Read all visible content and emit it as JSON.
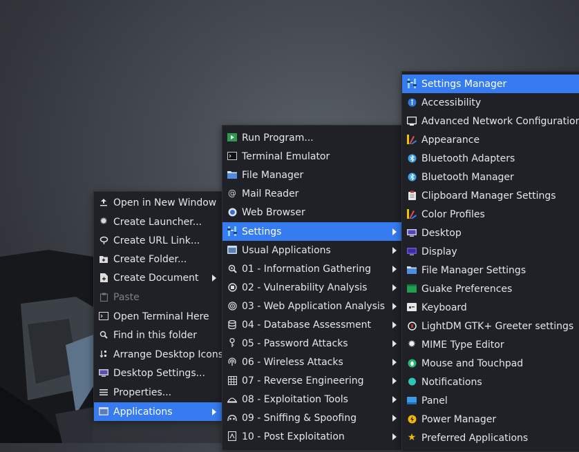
{
  "desktop_menu": {
    "items": [
      {
        "label": "Open in New Window",
        "icon": "upload-icon",
        "disabled": false,
        "submenu": false
      },
      {
        "label": "Create Launcher...",
        "icon": "gear-icon",
        "disabled": false,
        "submenu": false
      },
      {
        "label": "Create URL Link...",
        "icon": "link-icon",
        "disabled": false,
        "submenu": false
      },
      {
        "label": "Create Folder...",
        "icon": "folder-plus-icon",
        "disabled": false,
        "submenu": false
      },
      {
        "label": "Create Document",
        "icon": "document-plus-icon",
        "disabled": false,
        "submenu": true
      },
      {
        "label": "Paste",
        "icon": "clipboard-icon",
        "disabled": true,
        "submenu": false
      },
      {
        "label": "Open Terminal Here",
        "icon": "terminal-icon",
        "disabled": false,
        "submenu": false
      },
      {
        "label": "Find in this folder",
        "icon": "search-icon",
        "disabled": false,
        "submenu": false
      },
      {
        "label": "Arrange Desktop Icons",
        "icon": "arrange-icon",
        "disabled": false,
        "submenu": false
      },
      {
        "label": "Desktop Settings...",
        "icon": "desktop-icon",
        "disabled": false,
        "submenu": false
      },
      {
        "label": "Properties...",
        "icon": "list-icon",
        "disabled": false,
        "submenu": false
      },
      {
        "label": "Applications",
        "icon": "applications-icon",
        "disabled": false,
        "submenu": true,
        "selected": true
      }
    ]
  },
  "applications_menu": {
    "items": [
      {
        "label": "Run Program...",
        "icon": "run-icon",
        "submenu": false
      },
      {
        "label": "Terminal Emulator",
        "icon": "terminal-icon",
        "submenu": false
      },
      {
        "label": "File Manager",
        "icon": "folder-icon",
        "submenu": false
      },
      {
        "label": "Mail Reader",
        "icon": "mail-icon",
        "submenu": false
      },
      {
        "label": "Web Browser",
        "icon": "browser-icon",
        "submenu": false
      },
      {
        "label": "Settings",
        "icon": "settings-icon",
        "submenu": true,
        "selected": true
      },
      {
        "label": "Usual Applications",
        "icon": "usual-apps-icon",
        "submenu": true
      },
      {
        "label": "01 - Information Gathering",
        "icon": "magnifier-icon",
        "submenu": true
      },
      {
        "label": "02 - Vulnerability Analysis",
        "icon": "vulnerability-icon",
        "submenu": true
      },
      {
        "label": "03 - Web Application Analysis",
        "icon": "web-target-icon",
        "submenu": true
      },
      {
        "label": "04 - Database Assessment",
        "icon": "database-icon",
        "submenu": true
      },
      {
        "label": "05 - Password Attacks",
        "icon": "key-icon",
        "submenu": true
      },
      {
        "label": "06 - Wireless Attacks",
        "icon": "wireless-icon",
        "submenu": true
      },
      {
        "label": "07 - Reverse Engineering",
        "icon": "grid-icon",
        "submenu": true
      },
      {
        "label": "08 - Exploitation Tools",
        "icon": "exploit-icon",
        "submenu": true
      },
      {
        "label": "09 - Sniffing & Spoofing",
        "icon": "sniff-icon",
        "submenu": true
      },
      {
        "label": "10 - Post Exploitation",
        "icon": "post-exploit-icon",
        "submenu": true
      }
    ]
  },
  "settings_menu": {
    "items": [
      {
        "label": "Settings Manager",
        "icon": "settings-manager-icon",
        "selected": true
      },
      {
        "label": "Accessibility",
        "icon": "accessibility-icon"
      },
      {
        "label": "Advanced Network Configuration",
        "icon": "network-icon"
      },
      {
        "label": "Appearance",
        "icon": "appearance-icon"
      },
      {
        "label": "Bluetooth Adapters",
        "icon": "bluetooth-icon"
      },
      {
        "label": "Bluetooth Manager",
        "icon": "bluetooth-icon"
      },
      {
        "label": "Clipboard Manager Settings",
        "icon": "clipboard-manager-icon"
      },
      {
        "label": "Color Profiles",
        "icon": "color-profiles-icon"
      },
      {
        "label": "Desktop",
        "icon": "desktop-icon"
      },
      {
        "label": "Display",
        "icon": "display-icon"
      },
      {
        "label": "File Manager Settings",
        "icon": "folder-icon"
      },
      {
        "label": "Guake Preferences",
        "icon": "guake-icon"
      },
      {
        "label": "Keyboard",
        "icon": "keyboard-icon"
      },
      {
        "label": "LightDM GTK+ Greeter settings",
        "icon": "lightdm-icon"
      },
      {
        "label": "MIME Type Editor",
        "icon": "gear-icon"
      },
      {
        "label": "Mouse and Touchpad",
        "icon": "mouse-icon"
      },
      {
        "label": "Notifications",
        "icon": "notifications-icon"
      },
      {
        "label": "Panel",
        "icon": "panel-icon"
      },
      {
        "label": "Power Manager",
        "icon": "power-icon"
      },
      {
        "label": "Preferred Applications",
        "icon": "star-icon"
      }
    ]
  },
  "colors": {
    "menu_bg": "#1f2126",
    "selection": "#367bf0",
    "text": "#e6e6e6",
    "disabled_text": "#7d8086"
  }
}
